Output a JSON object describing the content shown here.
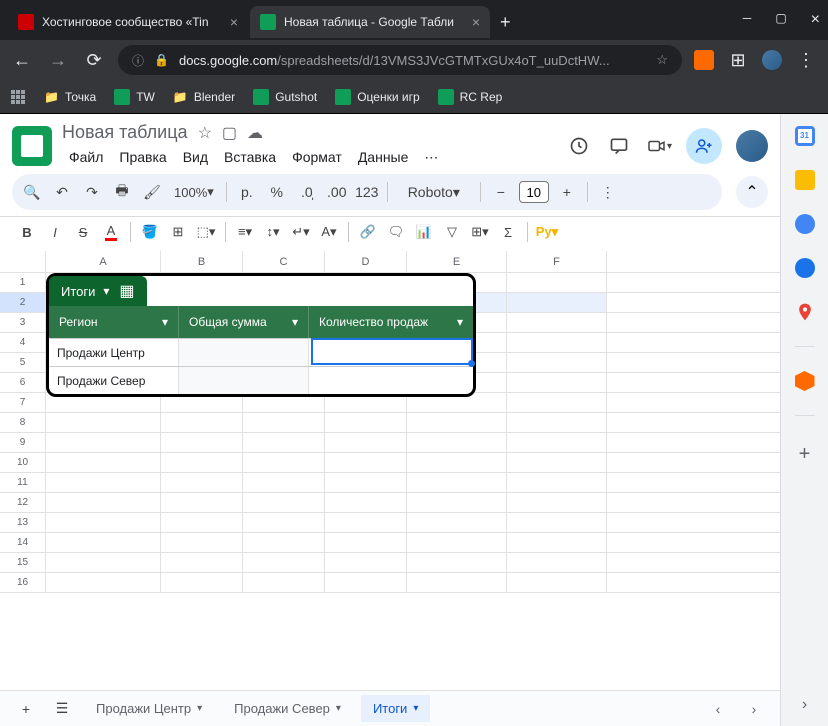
{
  "browser": {
    "tabs": [
      {
        "title": "Хостинговое сообщество «Tin",
        "favicon_color": "#cc0000"
      },
      {
        "title": "Новая таблица - Google Табли",
        "favicon_color": "#0f9d58"
      }
    ],
    "url_host": "docs.google.com",
    "url_path": "/spreadsheets/d/13VMS3JVcGTMTxGUx4oT_uuDctHW..."
  },
  "bookmarks": [
    {
      "label": "Точка",
      "type": "folder"
    },
    {
      "label": "TW",
      "type": "sheet"
    },
    {
      "label": "Blender",
      "type": "folder"
    },
    {
      "label": "Gutshot",
      "type": "sheet"
    },
    {
      "label": "Оценки игр",
      "type": "sheet"
    },
    {
      "label": "RC Rep",
      "type": "sheet"
    }
  ],
  "doc": {
    "title": "Новая таблица",
    "menus": [
      "Файл",
      "Правка",
      "Вид",
      "Вставка",
      "Формат",
      "Данные"
    ]
  },
  "toolbar": {
    "zoom": "100%",
    "currency": "р.",
    "font": "Roboto",
    "font_size": "10"
  },
  "columns": [
    "A",
    "B",
    "C",
    "D",
    "E",
    "F"
  ],
  "rows": [
    "1",
    "2",
    "3",
    "4",
    "5",
    "6",
    "7",
    "8",
    "9",
    "10",
    "11",
    "12",
    "13",
    "14",
    "15",
    "16"
  ],
  "selected_row": "2",
  "table": {
    "name": "Итоги",
    "headers": [
      "Регион",
      "Общая сумма",
      "Количество продаж"
    ],
    "rows": [
      {
        "region": "Продажи Центр",
        "sum": "",
        "count": ""
      },
      {
        "region": "Продажи Север",
        "sum": "",
        "count": ""
      }
    ]
  },
  "sheet_tabs": [
    {
      "label": "Продажи Центр",
      "active": false
    },
    {
      "label": "Продажи Север",
      "active": false
    },
    {
      "label": "Итоги",
      "active": true
    }
  ]
}
